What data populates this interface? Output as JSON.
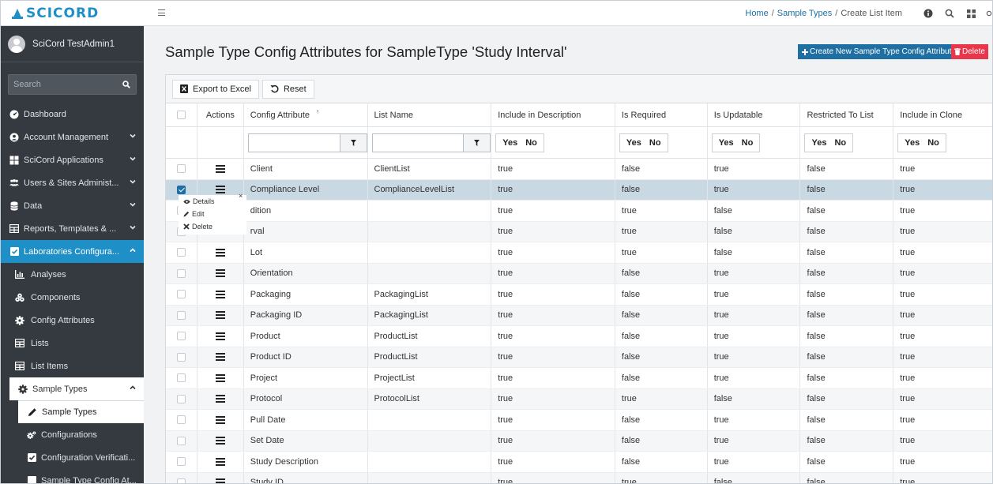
{
  "brand": {
    "name": "SCICORD",
    "color": "#1f8fc7"
  },
  "user": {
    "name": "SciCord TestAdmin1"
  },
  "search": {
    "placeholder": "Search"
  },
  "sidebar": {
    "items": [
      {
        "label": "Dashboard",
        "icon": "dashboard-icon"
      },
      {
        "label": "Account Management",
        "icon": "user-circle-icon"
      },
      {
        "label": "SciCord Applications",
        "icon": "apps-icon"
      },
      {
        "label": "Users & Sites Administ...",
        "icon": "users-icon"
      },
      {
        "label": "Data",
        "icon": "database-icon"
      },
      {
        "label": "Reports, Templates & ...",
        "icon": "table-icon"
      },
      {
        "label": "Laboratories Configura...",
        "icon": "check-square-icon"
      }
    ],
    "sub_items": [
      {
        "label": "Analyses",
        "icon": "chart-icon"
      },
      {
        "label": "Components",
        "icon": "components-icon"
      },
      {
        "label": "Config Attributes",
        "icon": "gear-icon"
      },
      {
        "label": "Lists",
        "icon": "table-icon"
      },
      {
        "label": "List Items",
        "icon": "table-icon"
      },
      {
        "label": "Sample Types",
        "icon": "gear-icon"
      },
      {
        "label": "Sample Types",
        "icon": "pencil-icon"
      },
      {
        "label": "Configurations",
        "icon": "gears-icon"
      },
      {
        "label": "Configuration Verificati...",
        "icon": "check-square-icon"
      },
      {
        "label": "Sample Type Config At...",
        "icon": "square-icon"
      }
    ]
  },
  "breadcrumb": {
    "home": "Home",
    "sample_types": "Sample Types",
    "current": "Create List Item",
    "sep": "/"
  },
  "page": {
    "title": "Sample Type Config Attributes for SampleType 'Study Interval'"
  },
  "actions": {
    "create": "Create New Sample Type Config Attribute",
    "delete": "Delete",
    "create_color": "#1f6fa3",
    "delete_color": "#e8364a"
  },
  "toolbar": {
    "export": "Export to Excel",
    "reset": "Reset"
  },
  "columns": [
    "Actions",
    "Config Attribute",
    "List Name",
    "Include in Description",
    "Is Required",
    "Is Updatable",
    "Restricted To List",
    "Include in Clone"
  ],
  "sort_mark": "↑",
  "filter": {
    "yes": "Yes",
    "no": "No"
  },
  "rows": [
    [
      "Client",
      "ClientList",
      "true",
      "false",
      "true",
      "false",
      "true"
    ],
    [
      "Compliance Level",
      "ComplianceLevelList",
      "true",
      "false",
      "true",
      "false",
      "true"
    ],
    [
      "dition",
      "",
      "true",
      "true",
      "false",
      "false",
      "true"
    ],
    [
      "rval",
      "",
      "true",
      "true",
      "false",
      "false",
      "true"
    ],
    [
      "Lot",
      "",
      "true",
      "true",
      "false",
      "false",
      "true"
    ],
    [
      "Orientation",
      "",
      "true",
      "false",
      "true",
      "false",
      "true"
    ],
    [
      "Packaging",
      "PackagingList",
      "true",
      "false",
      "true",
      "false",
      "true"
    ],
    [
      "Packaging ID",
      "PackagingList",
      "true",
      "false",
      "true",
      "false",
      "true"
    ],
    [
      "Product",
      "ProductList",
      "true",
      "false",
      "true",
      "false",
      "true"
    ],
    [
      "Product ID",
      "ProductList",
      "true",
      "false",
      "true",
      "false",
      "true"
    ],
    [
      "Project",
      "ProjectList",
      "true",
      "false",
      "true",
      "false",
      "true"
    ],
    [
      "Protocol",
      "ProtocolList",
      "true",
      "true",
      "false",
      "false",
      "true"
    ],
    [
      "Pull Date",
      "",
      "true",
      "false",
      "true",
      "false",
      "true"
    ],
    [
      "Set Date",
      "",
      "true",
      "false",
      "true",
      "false",
      "true"
    ],
    [
      "Study Description",
      "",
      "true",
      "false",
      "true",
      "false",
      "true"
    ],
    [
      "Study ID",
      "",
      "true",
      "true",
      "false",
      "false",
      "true"
    ]
  ],
  "context_menu": {
    "details": "Details",
    "edit": "Edit",
    "delete": "Delete"
  }
}
